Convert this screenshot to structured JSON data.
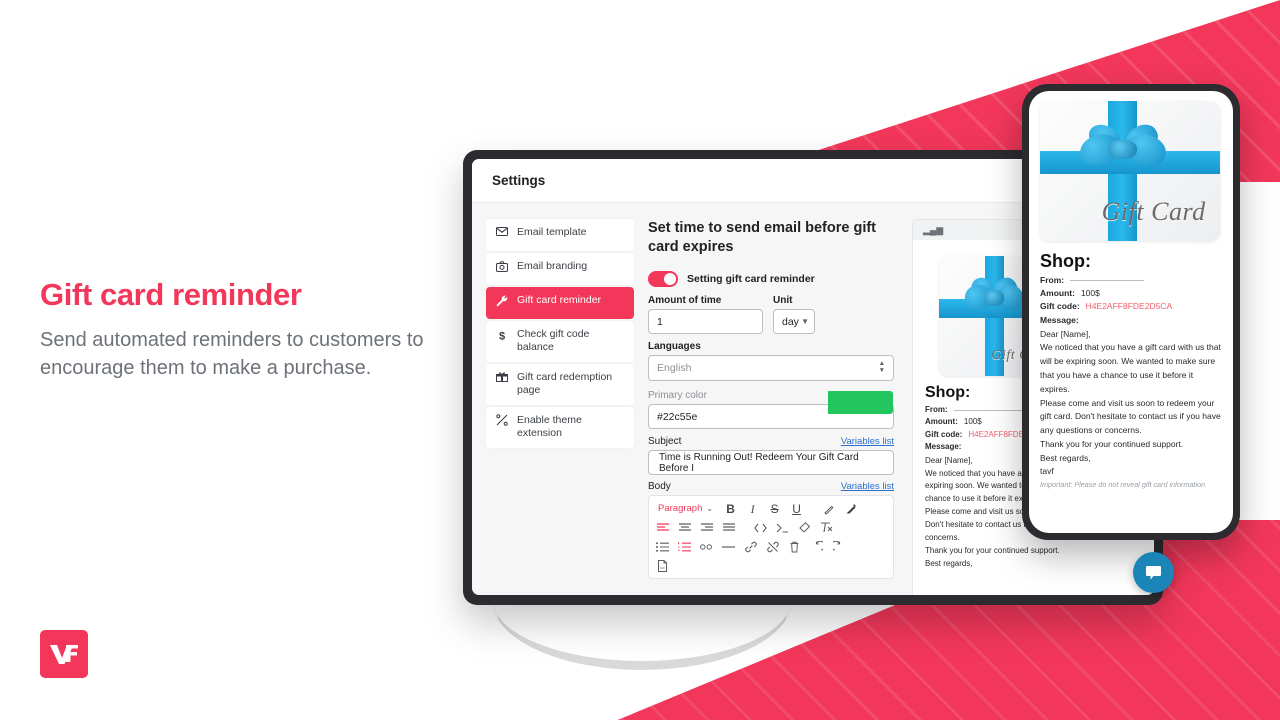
{
  "marketing": {
    "headline": "Gift card reminder",
    "body": "Send automated reminders to customers to encourage them to make a purchase.",
    "brand_color": "#f2375a",
    "logo_text": "VF"
  },
  "app": {
    "title": "Settings",
    "sidebar": {
      "items": [
        {
          "label": "Email template",
          "icon": "envelope-icon",
          "active": false
        },
        {
          "label": "Email branding",
          "icon": "camera-icon",
          "active": false
        },
        {
          "label": "Gift card reminder",
          "icon": "wrench-icon",
          "active": true
        },
        {
          "label": "Check gift code balance",
          "icon": "dollar-icon",
          "active": false
        },
        {
          "label": "Gift card redemption page",
          "icon": "gift-icon",
          "active": false
        },
        {
          "label": "Enable theme extension",
          "icon": "scissors-icon",
          "active": false
        }
      ]
    },
    "settings": {
      "section_title": "Set time to send email before gift card expires",
      "toggle_label": "Setting gift card reminder",
      "toggle_on": true,
      "amount_label": "Amount of time",
      "amount_value": "1",
      "unit_label": "Unit",
      "unit_value": "day",
      "languages_label": "Languages",
      "languages_value": "English",
      "primary_color_label": "Primary color",
      "primary_color_value": "#22c55e",
      "subject_label": "Subject",
      "subject_value": "Time is Running Out! Redeem Your Gift Card Before I",
      "body_label": "Body",
      "variables_link": "Variables list",
      "toolbar": {
        "block_format": "Paragraph",
        "row1": [
          "bold-icon",
          "italic-icon",
          "strikethrough-icon",
          "underline-icon",
          "highlighter-icon",
          "text-color-icon"
        ],
        "row2": [
          "align-left-icon",
          "align-center-icon",
          "align-right-icon",
          "align-justify-icon",
          "code-icon",
          "code-block-icon",
          "eraser-icon",
          "clear-format-icon"
        ],
        "row3": [
          "bullet-list-icon",
          "numbered-list-icon",
          "blockquote-icon",
          "horizontal-rule-icon",
          "link-icon",
          "unlink-icon",
          "trash-icon",
          "undo-icon",
          "redo-icon"
        ],
        "row4": [
          "source-file-icon"
        ]
      }
    },
    "preview": {
      "gift_card_word": "Gift Card",
      "shop_heading": "Shop:",
      "from_label": "From:",
      "from_value": "",
      "amount_label": "Amount:",
      "amount_value": "100$",
      "gift_code_label": "Gift code:",
      "gift_code_value": "H4E2AFF8FDE2D5CA",
      "message_label": "Message:",
      "message_lines": [
        "Dear [Name],",
        "We noticed that you have a gift card with us that will be expiring soon. We wanted to make sure that you have a chance to use it before it expires.",
        "Please come and visit us soon to redeem your gift card. Don't hesitate to contact us if you have any questions or concerns.",
        "Thank you for your continued support.",
        "Best regards,",
        "tavf"
      ],
      "footer_note": "Important: Please do not reveal gift card information"
    },
    "chat_widget": {
      "icon": "chat-bubble-icon"
    }
  }
}
